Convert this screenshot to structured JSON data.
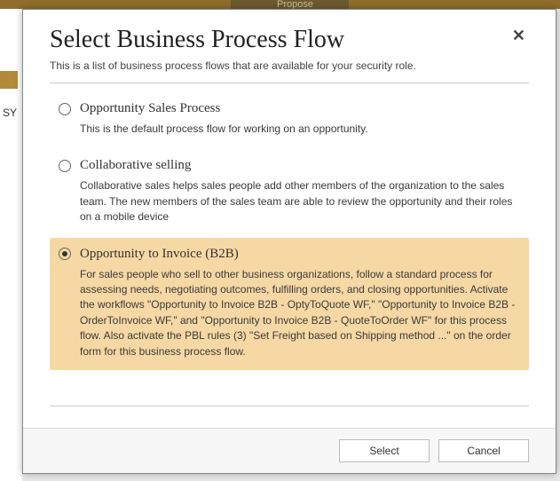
{
  "background": {
    "stage_label": "Propose",
    "cut_text": "SY"
  },
  "modal": {
    "title": "Select Business Process Flow",
    "subtitle": "This is a list of business process flows that are available for your security role.",
    "close_glyph": "✕",
    "options": [
      {
        "title": "Opportunity Sales Process",
        "description": "This is the default process flow for working on an opportunity.",
        "selected": false
      },
      {
        "title": "Collaborative selling",
        "description": "Collaborative sales helps sales people add other members of the organization to the sales team. The new members of the sales team are able to review the opportunity and their roles on a mobile device",
        "selected": false
      },
      {
        "title": "Opportunity to Invoice (B2B)",
        "description": "For sales people who sell to other business organizations, follow a standard process for assessing needs, negotiating outcomes, fulfilling orders, and closing opportunities. Activate the workflows \"Opportunity to Invoice B2B - OptyToQuote WF,\" \"Opportunity to Invoice B2B - OrderToInvoice WF,\" and \"Opportunity to Invoice B2B - QuoteToOrder WF\" for this process flow. Also activate the PBL rules (3) \"Set Freight based on Shipping method ...\" on the order form for this business process flow.",
        "selected": true
      }
    ],
    "footer": {
      "select_label": "Select",
      "cancel_label": "Cancel"
    }
  }
}
